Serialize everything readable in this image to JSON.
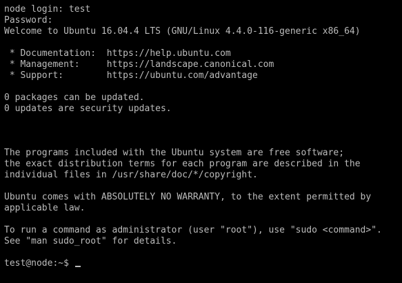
{
  "terminal": {
    "lines": [
      "node login: test",
      "Password:",
      "Welcome to Ubuntu 16.04.4 LTS (GNU/Linux 4.4.0-116-generic x86_64)",
      "",
      " * Documentation:  https://help.ubuntu.com",
      " * Management:     https://landscape.canonical.com",
      " * Support:        https://ubuntu.com/advantage",
      "",
      "0 packages can be updated.",
      "0 updates are security updates.",
      "",
      "",
      "",
      "The programs included with the Ubuntu system are free software;",
      "the exact distribution terms for each program are described in the",
      "individual files in /usr/share/doc/*/copyright.",
      "",
      "Ubuntu comes with ABSOLUTELY NO WARRANTY, to the extent permitted by",
      "applicable law.",
      "",
      "To run a command as administrator (user \"root\"), use \"sudo <command>\".",
      "See \"man sudo_root\" for details.",
      ""
    ],
    "prompt": "test@node:~$ ",
    "colors": {
      "background": "#000000",
      "foreground": "#bcbcbc"
    }
  }
}
